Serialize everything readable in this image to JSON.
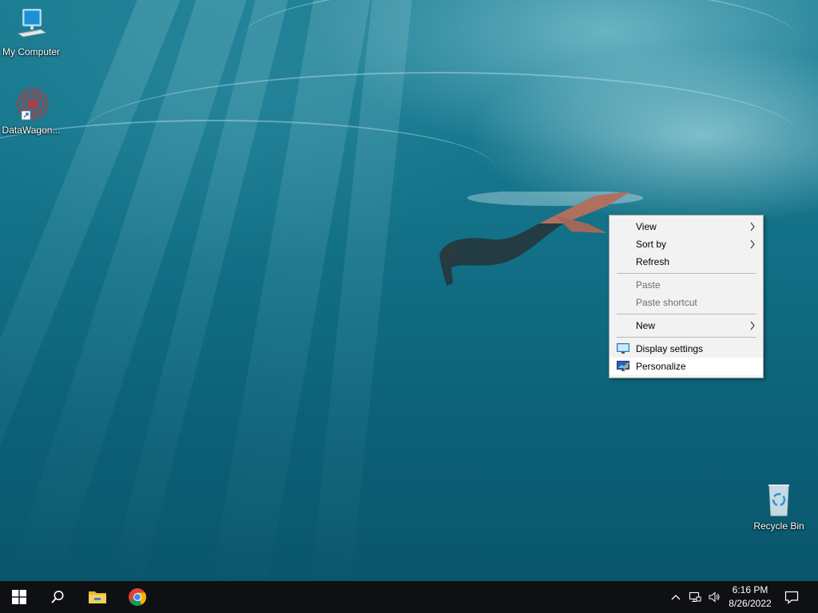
{
  "desktop": {
    "icons": [
      {
        "label": "My Computer",
        "icon": "monitor-computer-icon"
      },
      {
        "label": "DataWagon...",
        "icon": "datawagon-shortcut-icon"
      },
      {
        "label": "Recycle Bin",
        "icon": "recycle-bin-icon"
      }
    ]
  },
  "context_menu": {
    "items": [
      {
        "label": "View",
        "submenu": true,
        "enabled": true
      },
      {
        "label": "Sort by",
        "submenu": true,
        "enabled": true
      },
      {
        "label": "Refresh",
        "enabled": true
      },
      {
        "label": "Paste",
        "enabled": false
      },
      {
        "label": "Paste shortcut",
        "enabled": false
      },
      {
        "label": "New",
        "submenu": true,
        "enabled": true
      },
      {
        "label": "Display settings",
        "icon": "display-settings-icon",
        "enabled": true
      },
      {
        "label": "Personalize",
        "icon": "personalize-icon",
        "enabled": true,
        "hovered": true
      }
    ]
  },
  "taskbar": {
    "start": "windows-start-icon",
    "search": "search-icon",
    "pinned": [
      "file-explorer-icon",
      "chrome-icon"
    ],
    "tray": [
      "chevron-up-icon",
      "network-icon",
      "speaker-icon"
    ],
    "clock": {
      "time": "6:16 PM",
      "date": "8/26/2022"
    },
    "notifications": "action-center-icon"
  },
  "colors": {
    "taskbar": "#0f1013",
    "menu_bg": "#f2f2f2",
    "menu_disabled_text": "#6d6d6d",
    "water": "#137288"
  }
}
